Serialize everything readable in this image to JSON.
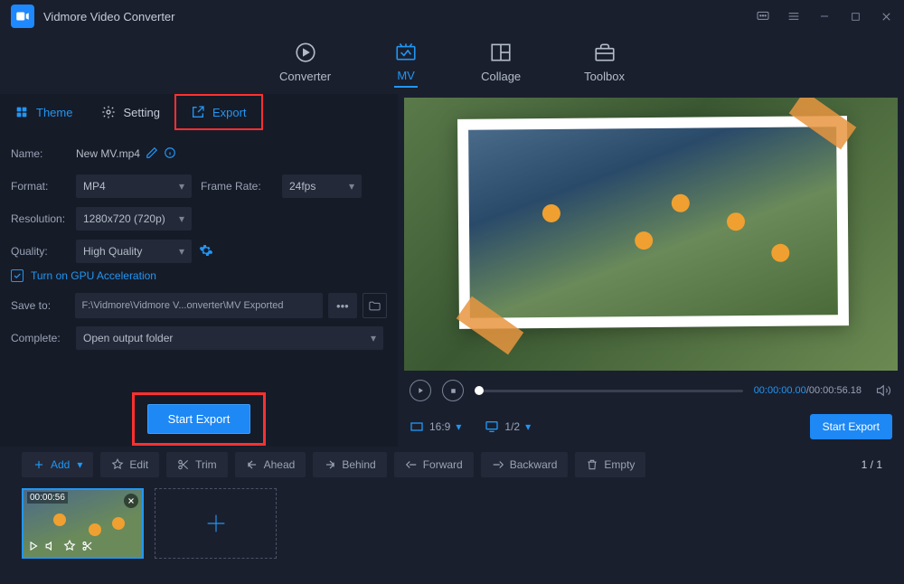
{
  "app_title": "Vidmore Video Converter",
  "nav": {
    "converter": "Converter",
    "mv": "MV",
    "collage": "Collage",
    "toolbox": "Toolbox"
  },
  "tabs": {
    "theme": "Theme",
    "setting": "Setting",
    "export": "Export"
  },
  "form": {
    "name_label": "Name:",
    "name_value": "New MV.mp4",
    "format_label": "Format:",
    "format_value": "MP4",
    "framerate_label": "Frame Rate:",
    "framerate_value": "24fps",
    "resolution_label": "Resolution:",
    "resolution_value": "1280x720 (720p)",
    "quality_label": "Quality:",
    "quality_value": "High Quality",
    "gpu_label": "Turn on GPU Acceleration",
    "saveto_label": "Save to:",
    "saveto_value": "F:\\Vidmore\\Vidmore V...onverter\\MV Exported",
    "complete_label": "Complete:",
    "complete_value": "Open output folder",
    "start_export": "Start Export"
  },
  "player": {
    "current_time": "00:00:00.00",
    "duration": "00:00:56.18",
    "aspect_ratio": "16:9",
    "page_ratio": "1/2",
    "start_export": "Start Export"
  },
  "toolbar": {
    "add": "Add",
    "edit": "Edit",
    "trim": "Trim",
    "ahead": "Ahead",
    "behind": "Behind",
    "forward": "Forward",
    "backward": "Backward",
    "empty": "Empty",
    "page_current": "1",
    "page_total": "1"
  },
  "clip": {
    "duration": "00:00:56"
  }
}
